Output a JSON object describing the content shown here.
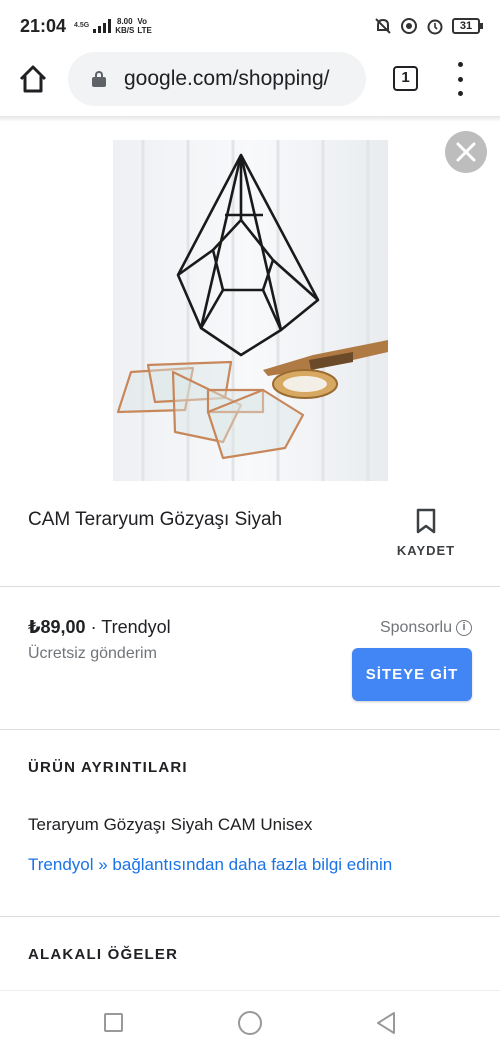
{
  "status_bar": {
    "time": "21:04",
    "network_small": "4.5G",
    "speed_value": "8.00",
    "speed_unit": "KB/S",
    "volte_top": "Vo",
    "volte_bottom": "LTE",
    "battery": "31"
  },
  "browser": {
    "url": "google.com/shopping/",
    "tab_count": "1"
  },
  "product": {
    "title": "CAM Teraryum Gözyaşı Siyah",
    "save_label": "KAYDET",
    "price": "₺89,00",
    "separator": " · ",
    "merchant": "Trendyol",
    "shipping": "Ücretsiz gönderim",
    "sponsored": "Sponsorlu",
    "visit_button": "SİTEYE GİT"
  },
  "details": {
    "heading": "ÜRÜN AYRINTILARI",
    "description": "Teraryum Gözyaşı Siyah CAM Unisex",
    "more_link": "Trendyol » bağlantısından daha fazla bilgi edinin"
  },
  "related": {
    "heading": "ALAKALI ÖĞELER"
  },
  "icons": {
    "home": "home-icon",
    "lock": "lock-icon",
    "menu": "more-vert-icon",
    "close": "close-icon",
    "bookmark": "bookmark-icon",
    "info": "info-icon"
  },
  "colors": {
    "accent": "#4285f4",
    "link": "#1a73e8",
    "secondary_text": "#70757a"
  }
}
